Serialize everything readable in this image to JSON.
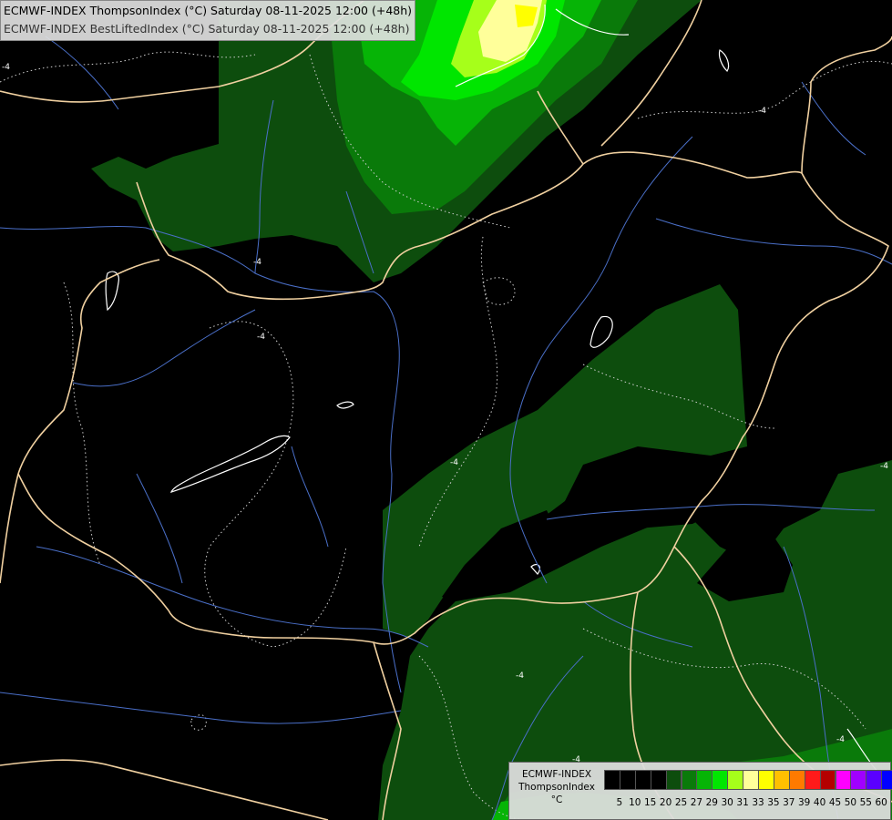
{
  "header": {
    "line1": "ECMWF-INDEX ThompsonIndex (°C) Saturday 08-11-2025 12:00 (+48h)",
    "line2": "ECMWF-INDEX BestLiftedIndex (°C) Saturday 08-11-2025 12:00 (+48h)"
  },
  "contour_labels": [
    "-4",
    "-4",
    "-4",
    "-4",
    "-4",
    "-4",
    "-4",
    "-4",
    "-4"
  ],
  "legend": {
    "title_lines": [
      "ECMWF-INDEX",
      "ThompsonIndex",
      "°C"
    ],
    "ticks": [
      "5",
      "10",
      "15",
      "20",
      "25",
      "27",
      "29",
      "30",
      "31",
      "33",
      "35",
      "37",
      "39",
      "40",
      "45",
      "50",
      "55",
      "60"
    ],
    "colors": [
      "#000000",
      "#000000",
      "#000000",
      "#000000",
      "#0d4d0d",
      "#0a7a0a",
      "#06b406",
      "#00e600",
      "#a6ff1a",
      "#ffff9a",
      "#ffff00",
      "#ffc000",
      "#ff7a00",
      "#ff1a1a",
      "#b40000",
      "#ff00ff",
      "#a000ff",
      "#5a00ff",
      "#0000ff"
    ]
  },
  "colors": {
    "green_dark": "#0d4d0d",
    "green_mid": "#0a7a0a",
    "green_bright": "#06b406",
    "green_lime": "#00e600",
    "yellow_green": "#a6ff1a",
    "pale_yellow": "#ffff9a",
    "border": "#f0d0a0",
    "river": "#4a6fc8",
    "dotted": "#d0d0d0"
  }
}
